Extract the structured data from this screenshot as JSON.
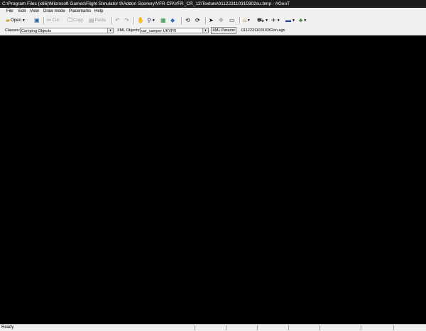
{
  "window": {
    "title": "C:\\Program Files (x86)\\Microsoft Games\\Flight Simulator 9\\Addon Scenery\\VFR CR\\VFR_CR_12\\Texture\\011223110310302su.bmp - AGenT"
  },
  "menu": {
    "items": [
      "File",
      "Edit",
      "View",
      "Draw mode",
      "Placemarks",
      "Help"
    ]
  },
  "toolbar": {
    "open_label": "Open",
    "cut_label": "Cut",
    "copy_label": "Copy",
    "paste_label": "Paste"
  },
  "classes": {
    "label": "Classes:",
    "value": "Camping Objects",
    "xml_label": "XML Objects:",
    "xml_value": "car_camper UKVFR",
    "params_button": "XML Params",
    "file_name": "011223110310302sn.agn"
  },
  "status": {
    "text": "Ready"
  },
  "colors": {
    "canvas": "#000000",
    "title_bar": "#1c1c1c",
    "chrome": "#f0f0f0"
  },
  "icons": [
    "open-icon",
    "save-icon",
    "cut-icon",
    "copy-icon",
    "paste-icon",
    "undo-icon",
    "redo-icon",
    "hand-icon",
    "zoom-icon",
    "layers-icon",
    "map-icon",
    "rotate-left-icon",
    "rotate-right-icon",
    "pointer-icon",
    "move-icon",
    "rectangle-icon",
    "building-icon",
    "vehicle-icon",
    "plane-icon",
    "truck-icon",
    "tree-icon"
  ]
}
